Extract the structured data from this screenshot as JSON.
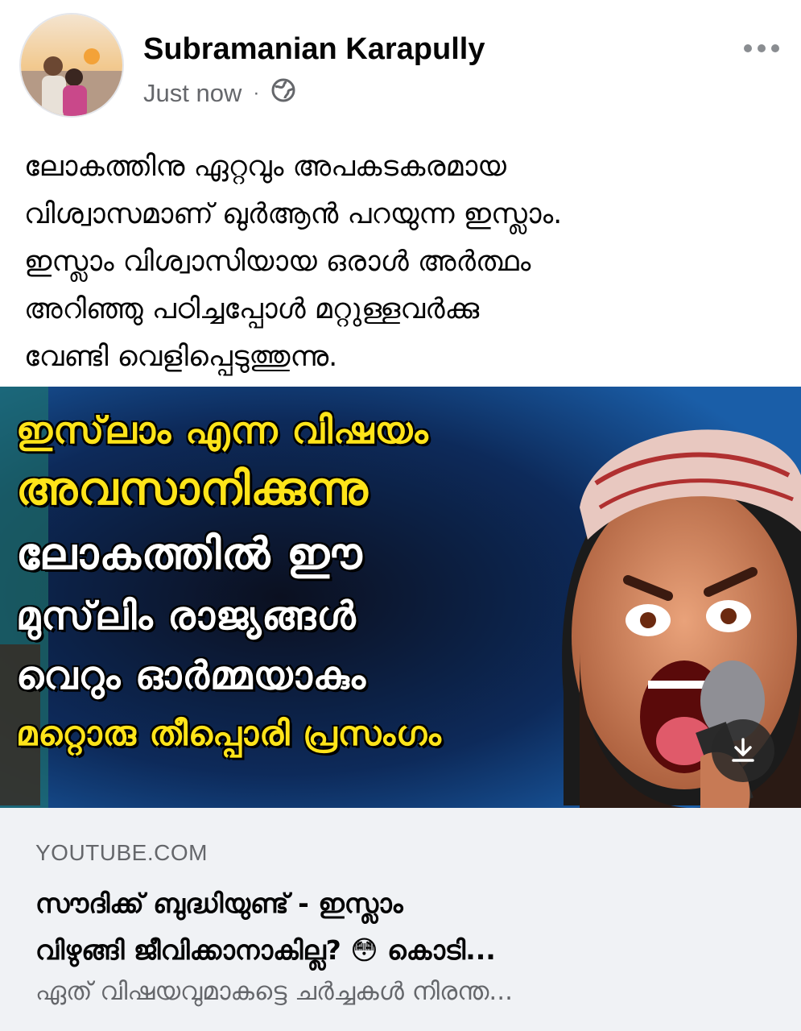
{
  "post": {
    "author": "Subramanian Karapully",
    "timestamp": "Just now",
    "separator": "·",
    "privacy_icon": "globe-icon",
    "more_icon": "more-dots-icon",
    "text_lines": [
      "ലോകത്തിനു ഏറ്റവും അപകടകരമായ",
      "വിശ്വാസമാണ് ഖുർആൻ പറയുന്ന  ഇസ്ലാം.",
      "ഇസ്ലാം വിശ്വാസിയായ ഒരാൾ അർത്ഥം",
      "അറിഞ്ഞു പഠിച്ചപ്പോൾ മറ്റുള്ളവർക്കു",
      "വേണ്ടി വെളിപ്പെടുത്തുന്നു."
    ]
  },
  "thumbnail": {
    "lines": [
      "ഇസ്‌ലാം എന്ന വിഷയം",
      "അവസാനിക്കുന്നു",
      "ലോകത്തിൽ ഈ",
      "മുസ്‌ലിം രാജ്യങ്ങൾ",
      "വെറും ഓർമ്മയാകും",
      "മറ്റൊരു തീപ്പൊരി പ്രസംഗം"
    ],
    "download_icon": "download-icon"
  },
  "link": {
    "domain": "YOUTUBE.COM",
    "title_lines": [
      "സൗദിക്ക് ബുദ്ധിയുണ്ട് - ഇസ്ലാം",
      "വിഴുങ്ങി ജീവിക്കാനാകില്ല? 😳 കൊടി..."
    ],
    "description": "ഏത് വിഷയവുമാകട്ടെ ചർച്ചകൾ നിരന്ത..."
  },
  "colors": {
    "name": "#050505",
    "meta": "#65676b",
    "card_bg": "#f0f2f5",
    "thumb_yellow": "#ffe419"
  }
}
